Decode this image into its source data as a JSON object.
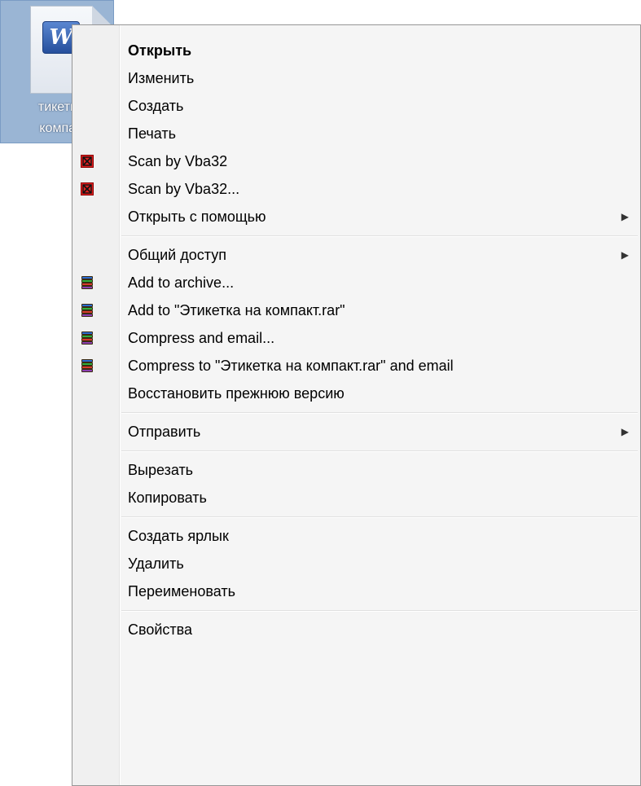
{
  "desktop_icon": {
    "name_line1": "тикетк",
    "name_line2": "компа",
    "icon": "word-document-icon",
    "badge_letter": "W"
  },
  "menu": {
    "items": [
      {
        "label": "Открыть",
        "default": true
      },
      {
        "label": "Изменить"
      },
      {
        "label": "Создать"
      },
      {
        "label": "Печать"
      },
      {
        "label": "Scan by Vba32",
        "icon": "vba32-icon"
      },
      {
        "label": "Scan by Vba32...",
        "icon": "vba32-icon"
      },
      {
        "label": "Открыть с помощью",
        "submenu": true
      },
      {
        "separator": true
      },
      {
        "label": "Общий доступ",
        "submenu": true
      },
      {
        "label": "Add to archive...",
        "icon": "winrar-icon"
      },
      {
        "label": "Add to \"Этикетка на компакт.rar\"",
        "icon": "winrar-icon"
      },
      {
        "label": "Compress and email...",
        "icon": "winrar-icon"
      },
      {
        "label": "Compress to \"Этикетка на компакт.rar\" and email",
        "icon": "winrar-icon"
      },
      {
        "label": "Восстановить прежнюю версию"
      },
      {
        "separator": true
      },
      {
        "label": "Отправить",
        "submenu": true
      },
      {
        "separator": true
      },
      {
        "label": "Вырезать"
      },
      {
        "label": "Копировать"
      },
      {
        "separator": true
      },
      {
        "label": "Создать ярлык"
      },
      {
        "label": "Удалить"
      },
      {
        "label": "Переименовать"
      },
      {
        "separator": true
      },
      {
        "label": "Свойства"
      }
    ],
    "submenu_arrow_glyph": "▶"
  },
  "colors": {
    "menu_background": "#f5f5f5",
    "vba32_icon": "#e02020",
    "desktop_icon_selection": "#9ab5d4"
  }
}
